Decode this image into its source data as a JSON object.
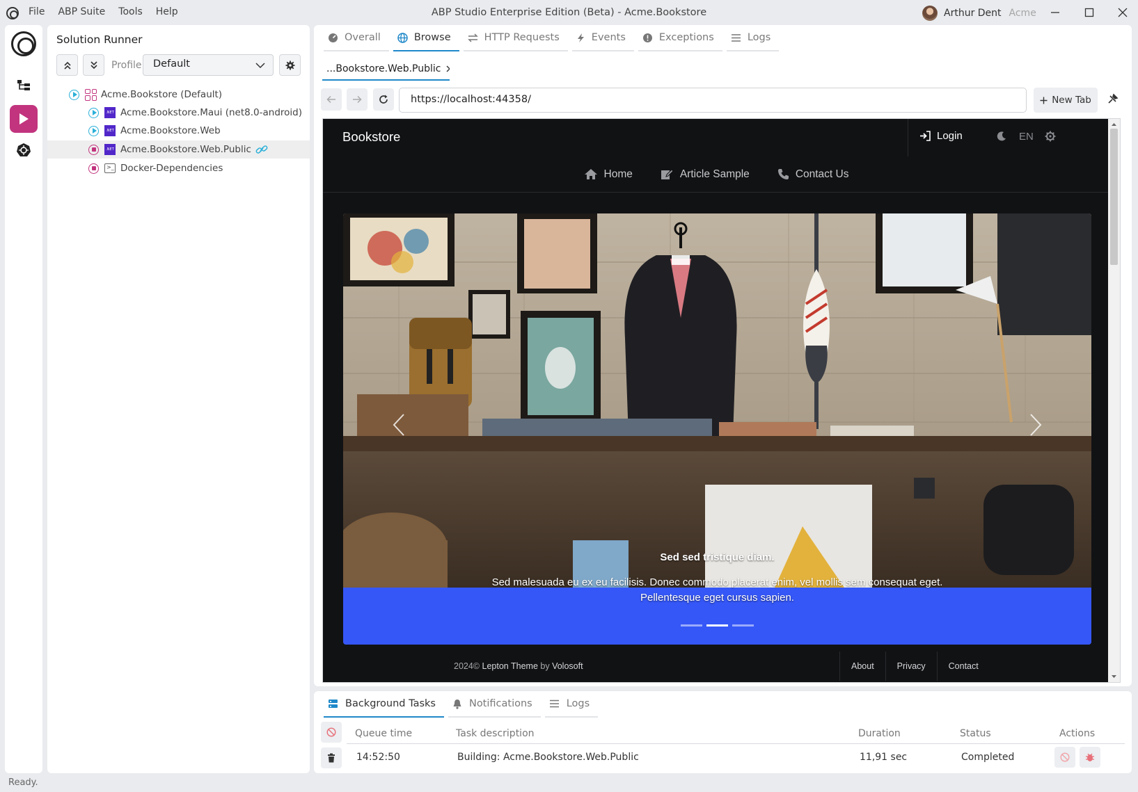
{
  "window": {
    "title": "ABP Studio Enterprise Edition (Beta) - Acme.Bookstore",
    "menu": [
      "File",
      "ABP Suite",
      "Tools",
      "Help"
    ],
    "user_name": "Arthur Dent",
    "tenant": "Acme",
    "minimize": "—",
    "maximize": "☐",
    "close": "✕"
  },
  "runner": {
    "title": "Solution Runner",
    "profile_label": "Profile:",
    "profile_value": "Default",
    "tree": [
      {
        "label": "Acme.Bookstore (Default)",
        "state": "run",
        "kind": "solution"
      },
      {
        "label": "Acme.Bookstore.Maui (net8.0-android)",
        "state": "run",
        "kind": "dotnet"
      },
      {
        "label": "Acme.Bookstore.Web",
        "state": "run",
        "kind": "dotnet"
      },
      {
        "label": "Acme.Bookstore.Web.Public",
        "state": "stop",
        "kind": "dotnet"
      },
      {
        "label": "Docker-Dependencies",
        "state": "stop",
        "kind": "terminal"
      }
    ],
    "net_badge": ".NET"
  },
  "main": {
    "tabs": [
      "Overall",
      "Browse",
      "HTTP Requests",
      "Events",
      "Exceptions",
      "Logs"
    ],
    "active_tab": "Browse",
    "doc_tab": "...Bookstore.Web.Public",
    "url": "https://localhost:44358/",
    "new_tab": "New Tab"
  },
  "site": {
    "brand": "Bookstore",
    "login": "Login",
    "lang": "EN",
    "nav": [
      "Home",
      "Article Sample",
      "Contact Us"
    ],
    "hero_title": "Sed sed tristique diam.",
    "hero_text": "Sed malesuada eu ex eu facilisis. Donec commodo placerat enim, vel mollis sem consequat eget. Pellentesque eget cursus sapien.",
    "footer_year": "2024©",
    "footer_theme": "Lepton Theme",
    "footer_by": "by",
    "footer_company": "Volosoft",
    "footer_links": [
      "About",
      "Privacy",
      "Contact"
    ],
    "accent": "#3557f7"
  },
  "bottom": {
    "tabs": [
      "Background Tasks",
      "Notifications",
      "Logs"
    ],
    "columns": [
      "Queue time",
      "Task description",
      "Duration",
      "Status",
      "Actions"
    ],
    "rows": [
      {
        "time": "14:52:50",
        "description": "Building: Acme.Bookstore.Web.Public",
        "duration": "11,91 sec",
        "status": "Completed"
      }
    ]
  },
  "status": "Ready.",
  "colors": {
    "brand": "#c2347e",
    "active_tab": "#1e88c9",
    "dotnet": "#5127c9"
  }
}
